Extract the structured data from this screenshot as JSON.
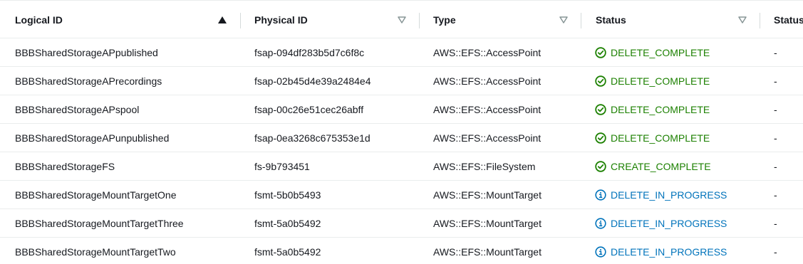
{
  "columns": [
    {
      "label": "Logical ID"
    },
    {
      "label": "Physical ID"
    },
    {
      "label": "Type"
    },
    {
      "label": "Status"
    },
    {
      "label": "Status"
    }
  ],
  "colors": {
    "complete": "#1d8102",
    "in_progress": "#0073bb"
  },
  "rows": [
    {
      "logical_id": "BBBSharedStorageAPpublished",
      "physical_id": "fsap-094df283b5d7c6f8c",
      "type": "AWS::EFS::AccessPoint",
      "status": "DELETE_COMPLETE",
      "status_kind": "complete",
      "status_reason": "-"
    },
    {
      "logical_id": "BBBSharedStorageAPrecordings",
      "physical_id": "fsap-02b45d4e39a2484e4",
      "type": "AWS::EFS::AccessPoint",
      "status": "DELETE_COMPLETE",
      "status_kind": "complete",
      "status_reason": "-"
    },
    {
      "logical_id": "BBBSharedStorageAPspool",
      "physical_id": "fsap-00c26e51cec26abff",
      "type": "AWS::EFS::AccessPoint",
      "status": "DELETE_COMPLETE",
      "status_kind": "complete",
      "status_reason": "-"
    },
    {
      "logical_id": "BBBSharedStorageAPunpublished",
      "physical_id": "fsap-0ea3268c675353e1d",
      "type": "AWS::EFS::AccessPoint",
      "status": "DELETE_COMPLETE",
      "status_kind": "complete",
      "status_reason": "-"
    },
    {
      "logical_id": "BBBSharedStorageFS",
      "physical_id": "fs-9b793451",
      "type": "AWS::EFS::FileSystem",
      "status": "CREATE_COMPLETE",
      "status_kind": "complete",
      "status_reason": "-"
    },
    {
      "logical_id": "BBBSharedStorageMountTargetOne",
      "physical_id": "fsmt-5b0b5493",
      "type": "AWS::EFS::MountTarget",
      "status": "DELETE_IN_PROGRESS",
      "status_kind": "in_progress",
      "status_reason": "-"
    },
    {
      "logical_id": "BBBSharedStorageMountTargetThree",
      "physical_id": "fsmt-5a0b5492",
      "type": "AWS::EFS::MountTarget",
      "status": "DELETE_IN_PROGRESS",
      "status_kind": "in_progress",
      "status_reason": "-"
    },
    {
      "logical_id": "BBBSharedStorageMountTargetTwo",
      "physical_id": "fsmt-5a0b5492",
      "type": "AWS::EFS::MountTarget",
      "status": "DELETE_IN_PROGRESS",
      "status_kind": "in_progress",
      "status_reason": "-"
    }
  ]
}
